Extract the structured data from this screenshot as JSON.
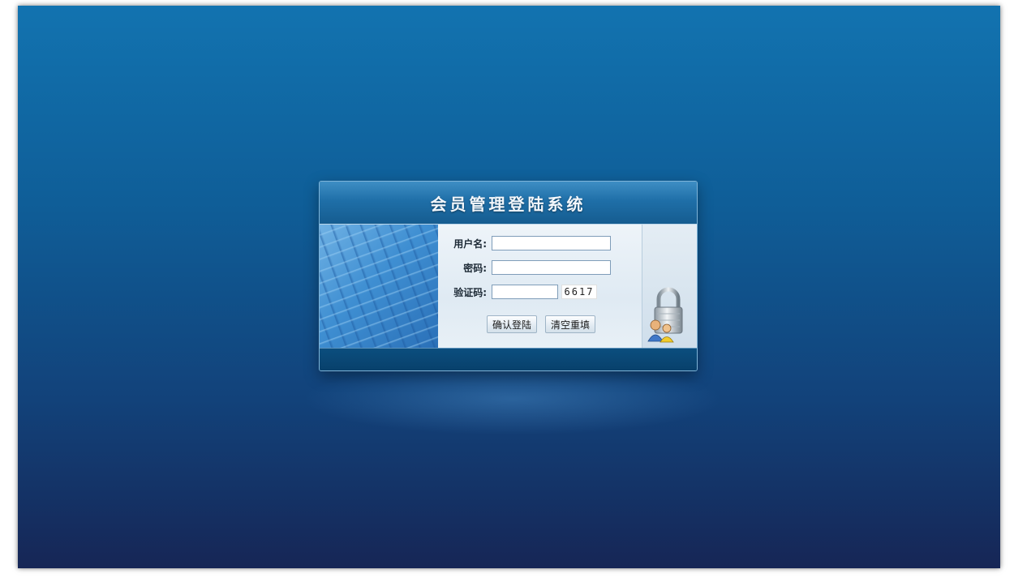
{
  "panel": {
    "title": "会员管理登陆系统"
  },
  "form": {
    "username_label": "用户名:",
    "username_value": "",
    "password_label": "密码:",
    "password_value": "",
    "captcha_label": "验证码:",
    "captcha_value": "",
    "captcha_code": "6617"
  },
  "buttons": {
    "login_label": "确认登陆",
    "reset_label": "清空重填"
  },
  "icons": {
    "keyboard": "keyboard-image",
    "lock": "lock-users-icon"
  },
  "colors": {
    "background_top": "#1273b0",
    "background_bottom": "#162656",
    "title_bar": "#1f6fa8",
    "form_bg": "#e8f0f6"
  }
}
